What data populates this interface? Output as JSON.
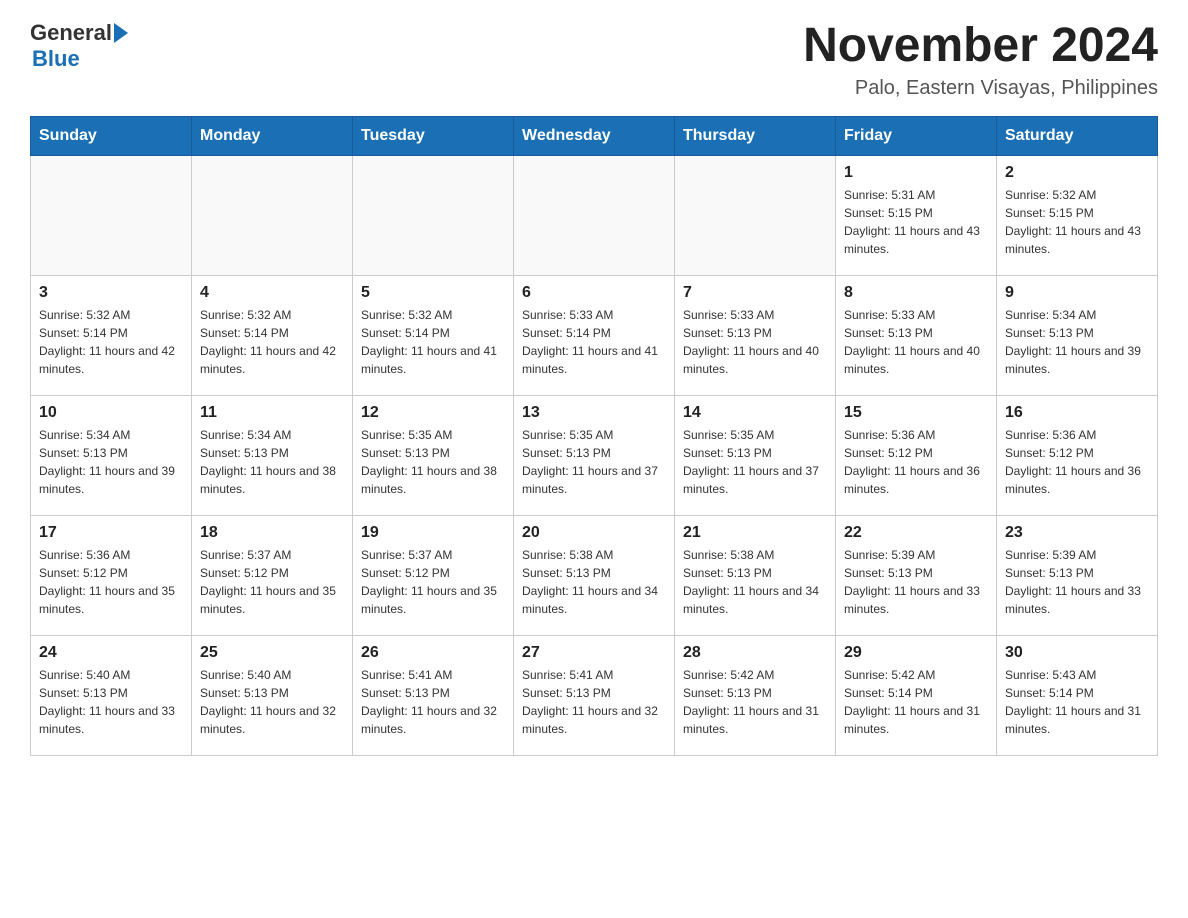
{
  "logo": {
    "general": "General",
    "blue": "Blue"
  },
  "header": {
    "month_year": "November 2024",
    "location": "Palo, Eastern Visayas, Philippines"
  },
  "days_of_week": [
    "Sunday",
    "Monday",
    "Tuesday",
    "Wednesday",
    "Thursday",
    "Friday",
    "Saturday"
  ],
  "weeks": [
    [
      {
        "day": "",
        "info": ""
      },
      {
        "day": "",
        "info": ""
      },
      {
        "day": "",
        "info": ""
      },
      {
        "day": "",
        "info": ""
      },
      {
        "day": "",
        "info": ""
      },
      {
        "day": "1",
        "info": "Sunrise: 5:31 AM\nSunset: 5:15 PM\nDaylight: 11 hours and 43 minutes."
      },
      {
        "day": "2",
        "info": "Sunrise: 5:32 AM\nSunset: 5:15 PM\nDaylight: 11 hours and 43 minutes."
      }
    ],
    [
      {
        "day": "3",
        "info": "Sunrise: 5:32 AM\nSunset: 5:14 PM\nDaylight: 11 hours and 42 minutes."
      },
      {
        "day": "4",
        "info": "Sunrise: 5:32 AM\nSunset: 5:14 PM\nDaylight: 11 hours and 42 minutes."
      },
      {
        "day": "5",
        "info": "Sunrise: 5:32 AM\nSunset: 5:14 PM\nDaylight: 11 hours and 41 minutes."
      },
      {
        "day": "6",
        "info": "Sunrise: 5:33 AM\nSunset: 5:14 PM\nDaylight: 11 hours and 41 minutes."
      },
      {
        "day": "7",
        "info": "Sunrise: 5:33 AM\nSunset: 5:13 PM\nDaylight: 11 hours and 40 minutes."
      },
      {
        "day": "8",
        "info": "Sunrise: 5:33 AM\nSunset: 5:13 PM\nDaylight: 11 hours and 40 minutes."
      },
      {
        "day": "9",
        "info": "Sunrise: 5:34 AM\nSunset: 5:13 PM\nDaylight: 11 hours and 39 minutes."
      }
    ],
    [
      {
        "day": "10",
        "info": "Sunrise: 5:34 AM\nSunset: 5:13 PM\nDaylight: 11 hours and 39 minutes."
      },
      {
        "day": "11",
        "info": "Sunrise: 5:34 AM\nSunset: 5:13 PM\nDaylight: 11 hours and 38 minutes."
      },
      {
        "day": "12",
        "info": "Sunrise: 5:35 AM\nSunset: 5:13 PM\nDaylight: 11 hours and 38 minutes."
      },
      {
        "day": "13",
        "info": "Sunrise: 5:35 AM\nSunset: 5:13 PM\nDaylight: 11 hours and 37 minutes."
      },
      {
        "day": "14",
        "info": "Sunrise: 5:35 AM\nSunset: 5:13 PM\nDaylight: 11 hours and 37 minutes."
      },
      {
        "day": "15",
        "info": "Sunrise: 5:36 AM\nSunset: 5:12 PM\nDaylight: 11 hours and 36 minutes."
      },
      {
        "day": "16",
        "info": "Sunrise: 5:36 AM\nSunset: 5:12 PM\nDaylight: 11 hours and 36 minutes."
      }
    ],
    [
      {
        "day": "17",
        "info": "Sunrise: 5:36 AM\nSunset: 5:12 PM\nDaylight: 11 hours and 35 minutes."
      },
      {
        "day": "18",
        "info": "Sunrise: 5:37 AM\nSunset: 5:12 PM\nDaylight: 11 hours and 35 minutes."
      },
      {
        "day": "19",
        "info": "Sunrise: 5:37 AM\nSunset: 5:12 PM\nDaylight: 11 hours and 35 minutes."
      },
      {
        "day": "20",
        "info": "Sunrise: 5:38 AM\nSunset: 5:13 PM\nDaylight: 11 hours and 34 minutes."
      },
      {
        "day": "21",
        "info": "Sunrise: 5:38 AM\nSunset: 5:13 PM\nDaylight: 11 hours and 34 minutes."
      },
      {
        "day": "22",
        "info": "Sunrise: 5:39 AM\nSunset: 5:13 PM\nDaylight: 11 hours and 33 minutes."
      },
      {
        "day": "23",
        "info": "Sunrise: 5:39 AM\nSunset: 5:13 PM\nDaylight: 11 hours and 33 minutes."
      }
    ],
    [
      {
        "day": "24",
        "info": "Sunrise: 5:40 AM\nSunset: 5:13 PM\nDaylight: 11 hours and 33 minutes."
      },
      {
        "day": "25",
        "info": "Sunrise: 5:40 AM\nSunset: 5:13 PM\nDaylight: 11 hours and 32 minutes."
      },
      {
        "day": "26",
        "info": "Sunrise: 5:41 AM\nSunset: 5:13 PM\nDaylight: 11 hours and 32 minutes."
      },
      {
        "day": "27",
        "info": "Sunrise: 5:41 AM\nSunset: 5:13 PM\nDaylight: 11 hours and 32 minutes."
      },
      {
        "day": "28",
        "info": "Sunrise: 5:42 AM\nSunset: 5:13 PM\nDaylight: 11 hours and 31 minutes."
      },
      {
        "day": "29",
        "info": "Sunrise: 5:42 AM\nSunset: 5:14 PM\nDaylight: 11 hours and 31 minutes."
      },
      {
        "day": "30",
        "info": "Sunrise: 5:43 AM\nSunset: 5:14 PM\nDaylight: 11 hours and 31 minutes."
      }
    ]
  ]
}
